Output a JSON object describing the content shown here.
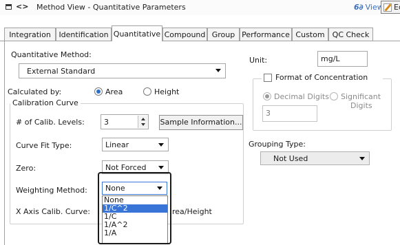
{
  "titlebar": {
    "nav_glyph": "<>",
    "title": "Method View - Quantitative Parameters",
    "view_glyph": "6∂",
    "view_label": "View",
    "edit_label": "Edit"
  },
  "tabs": [
    {
      "label": "Integration"
    },
    {
      "label": "Identification"
    },
    {
      "label": "Quantitative",
      "active": true
    },
    {
      "label": "Compound"
    },
    {
      "label": "Group"
    },
    {
      "label": "Performance"
    },
    {
      "label": "Custom"
    },
    {
      "label": "QC Check"
    }
  ],
  "quant": {
    "method_label": "Quantitative Method:",
    "method_value": "External Standard",
    "calc_label": "Calculated by:",
    "calc_options": [
      "Area",
      "Height"
    ],
    "calc_selected": "Area"
  },
  "calibration": {
    "group_title": "Calibration Curve",
    "levels_label": "# of Calib. Levels:",
    "levels_value": "3",
    "sample_info_button": "Sample Information...",
    "curve_fit_label": "Curve Fit Type:",
    "curve_fit_value": "Linear",
    "zero_label": "Zero:",
    "zero_value": "Not Forced",
    "weighting_label": "Weighting Method:",
    "weighting_value": "None",
    "xaxis_label": "X Axis Calib. Curve:",
    "xaxis_value_partial": "rea/Height"
  },
  "weighting_dropdown": {
    "options": [
      "None",
      "1/C^2",
      "1/C",
      "1/A^2",
      "1/A"
    ],
    "highlighted": "1/C^2"
  },
  "unit": {
    "label": "Unit:",
    "value": "mg/L"
  },
  "concentration": {
    "group_title": "Format of Concentration",
    "checked": false,
    "option_decimal": "Decimal Digits",
    "option_significant_line1": "Significant",
    "option_significant_line2": "Digits",
    "selected": "Decimal Digits",
    "digits_value": "3"
  },
  "grouping": {
    "label": "Grouping Type:",
    "value": "Not Used"
  }
}
